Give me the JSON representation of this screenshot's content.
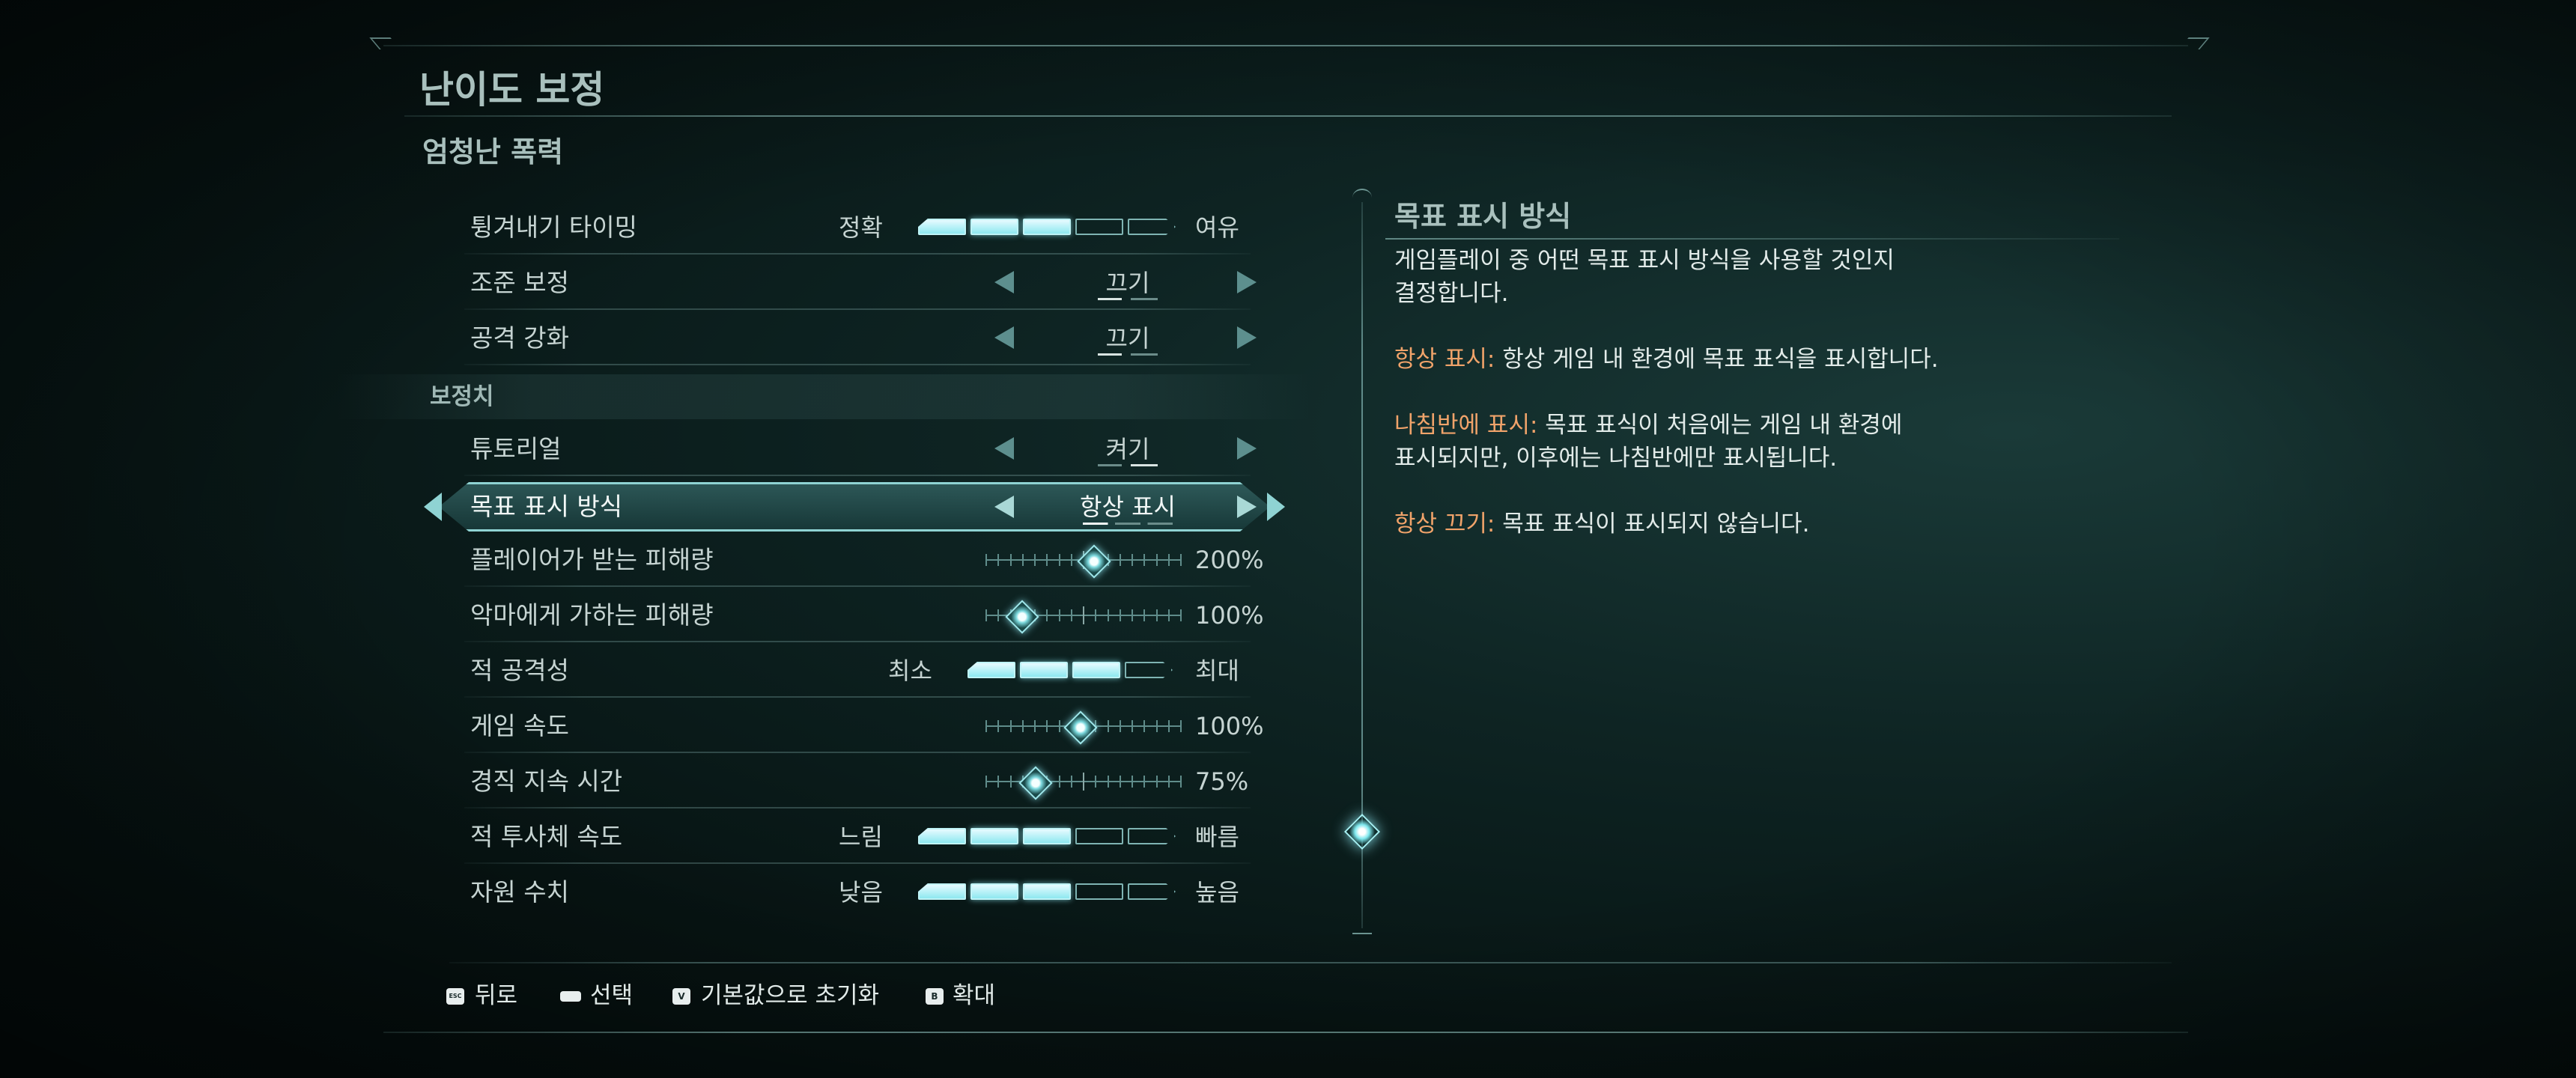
{
  "page": {
    "title": "난이도 보정",
    "subtitle": "엄청난 폭력"
  },
  "settings": [
    {
      "label": "튕겨내기 타이밍",
      "type": "segments",
      "left": "정확",
      "right": "여유",
      "level": 3,
      "max": 5
    },
    {
      "label": "조준 보정",
      "type": "option",
      "value": "끄기"
    },
    {
      "label": "공격 강화",
      "type": "option",
      "value": "끄기"
    },
    {
      "label": "튜토리얼",
      "type": "option",
      "value": "켜기"
    },
    {
      "label": "목표 표시 방식",
      "type": "option",
      "value": "항상 표시",
      "selected": true
    },
    {
      "label": "플레이어가 받는 피해량",
      "type": "slider",
      "value": "200%",
      "fraction": 0.55
    },
    {
      "label": "악마에게 가하는 피해량",
      "type": "slider",
      "value": "100%",
      "fraction": 0.18
    },
    {
      "label": "적 공격성",
      "type": "segments",
      "left": "최소",
      "right": "최대",
      "level": 3,
      "max": 4
    },
    {
      "label": "게임 속도",
      "type": "slider",
      "value": "100%",
      "fraction": 0.48
    },
    {
      "label": "경직 지속 시간",
      "type": "slider",
      "value": "75%",
      "fraction": 0.25
    },
    {
      "label": "적 투사체 속도",
      "type": "segments",
      "left": "느림",
      "right": "빠름",
      "level": 3,
      "max": 5
    },
    {
      "label": "자원 수치",
      "type": "segments",
      "left": "낮음",
      "right": "높음",
      "level": 3,
      "max": 5
    }
  ],
  "section_label": "보정치",
  "description": {
    "title": "목표 표시 방식",
    "intro_line1": "게임플레이 중 어떤 목표 표시 방식을 사용할 것인지",
    "intro_line2": "결정합니다.",
    "opt1_name": "항상 표시:",
    "opt1_text": " 항상 게임 내 환경에 목표 표식을 표시합니다.",
    "opt2_name": "나침반에 표시:",
    "opt2_text_line1": " 목표 표식이 처음에는 게임 내 환경에",
    "opt2_text_line2": "표시되지만, 이후에는 나침반에만 표시됩니다.",
    "opt3_name": "항상 끄기:",
    "opt3_text": " 목표 표식이 표시되지 않습니다."
  },
  "footer": {
    "back": {
      "key": "ESC",
      "label": "뒤로"
    },
    "select": {
      "key": "",
      "label": "선택"
    },
    "reset": {
      "key": "V",
      "label": "기본값으로 초기화"
    },
    "zoom": {
      "key": "B",
      "label": "확대"
    }
  },
  "colors": {
    "accent": "#8ee8f0",
    "highlight": "#f0a36a",
    "text": "#c6d4d2"
  }
}
